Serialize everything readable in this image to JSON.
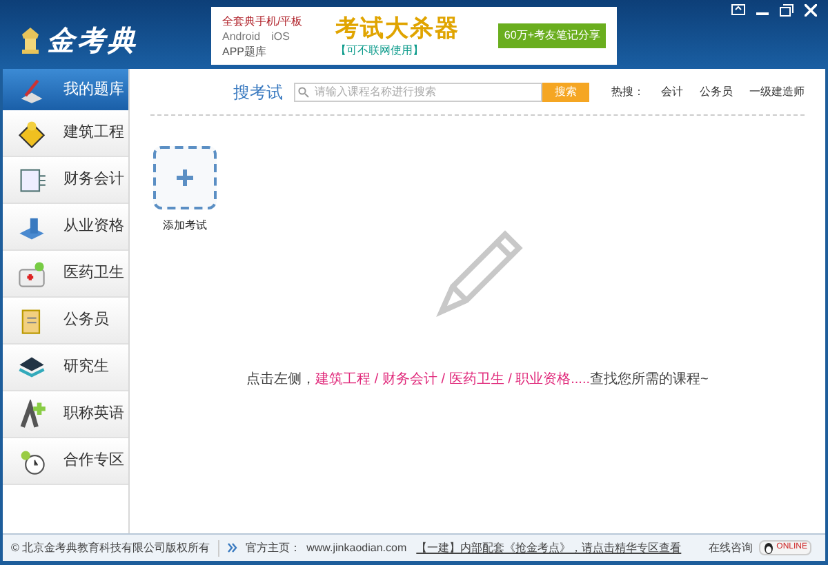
{
  "app": {
    "logo": "金考典"
  },
  "ad": {
    "line_1": "全套典手机/平板",
    "platforms": [
      "Android",
      "iOS"
    ],
    "headline": "考试大杀器",
    "badge": "60万+考友笔记分享",
    "subline": "APP题库",
    "note": "【可不联网使用】"
  },
  "sidebar": {
    "items": [
      {
        "label": "我的题库",
        "selected": true
      },
      {
        "label": "建筑工程",
        "selected": false
      },
      {
        "label": "财务会计",
        "selected": false
      },
      {
        "label": "从业资格",
        "selected": false
      },
      {
        "label": "医药卫生",
        "selected": false
      },
      {
        "label": "公务员",
        "selected": false
      },
      {
        "label": "研究生",
        "selected": false
      },
      {
        "label": "职称英语",
        "selected": false
      },
      {
        "label": "合作专区",
        "selected": false
      }
    ]
  },
  "search": {
    "label": "搜考试",
    "placeholder": "请输入课程名称进行搜索",
    "button": "搜索",
    "hot_label": "热搜：",
    "hot": [
      "会计",
      "公务员",
      "一级建造师"
    ]
  },
  "add_exam": {
    "label": "添加考试"
  },
  "hint": {
    "lead": "点击左侧，",
    "categories": "建筑工程 / 财务会计 / 医药卫生 / 职业资格.....",
    "tail": "查找您所需的课程~"
  },
  "status_bar": {
    "copyright": "© 北京金考典教育科技有限公司版权所有",
    "site_label": "官方主页：",
    "site": "www.jinkaodian.com",
    "notice": "【一建】内部配套《抢金考点》，请点击精华专区查看",
    "consult": "在线咨询",
    "online": "ONLINE"
  }
}
